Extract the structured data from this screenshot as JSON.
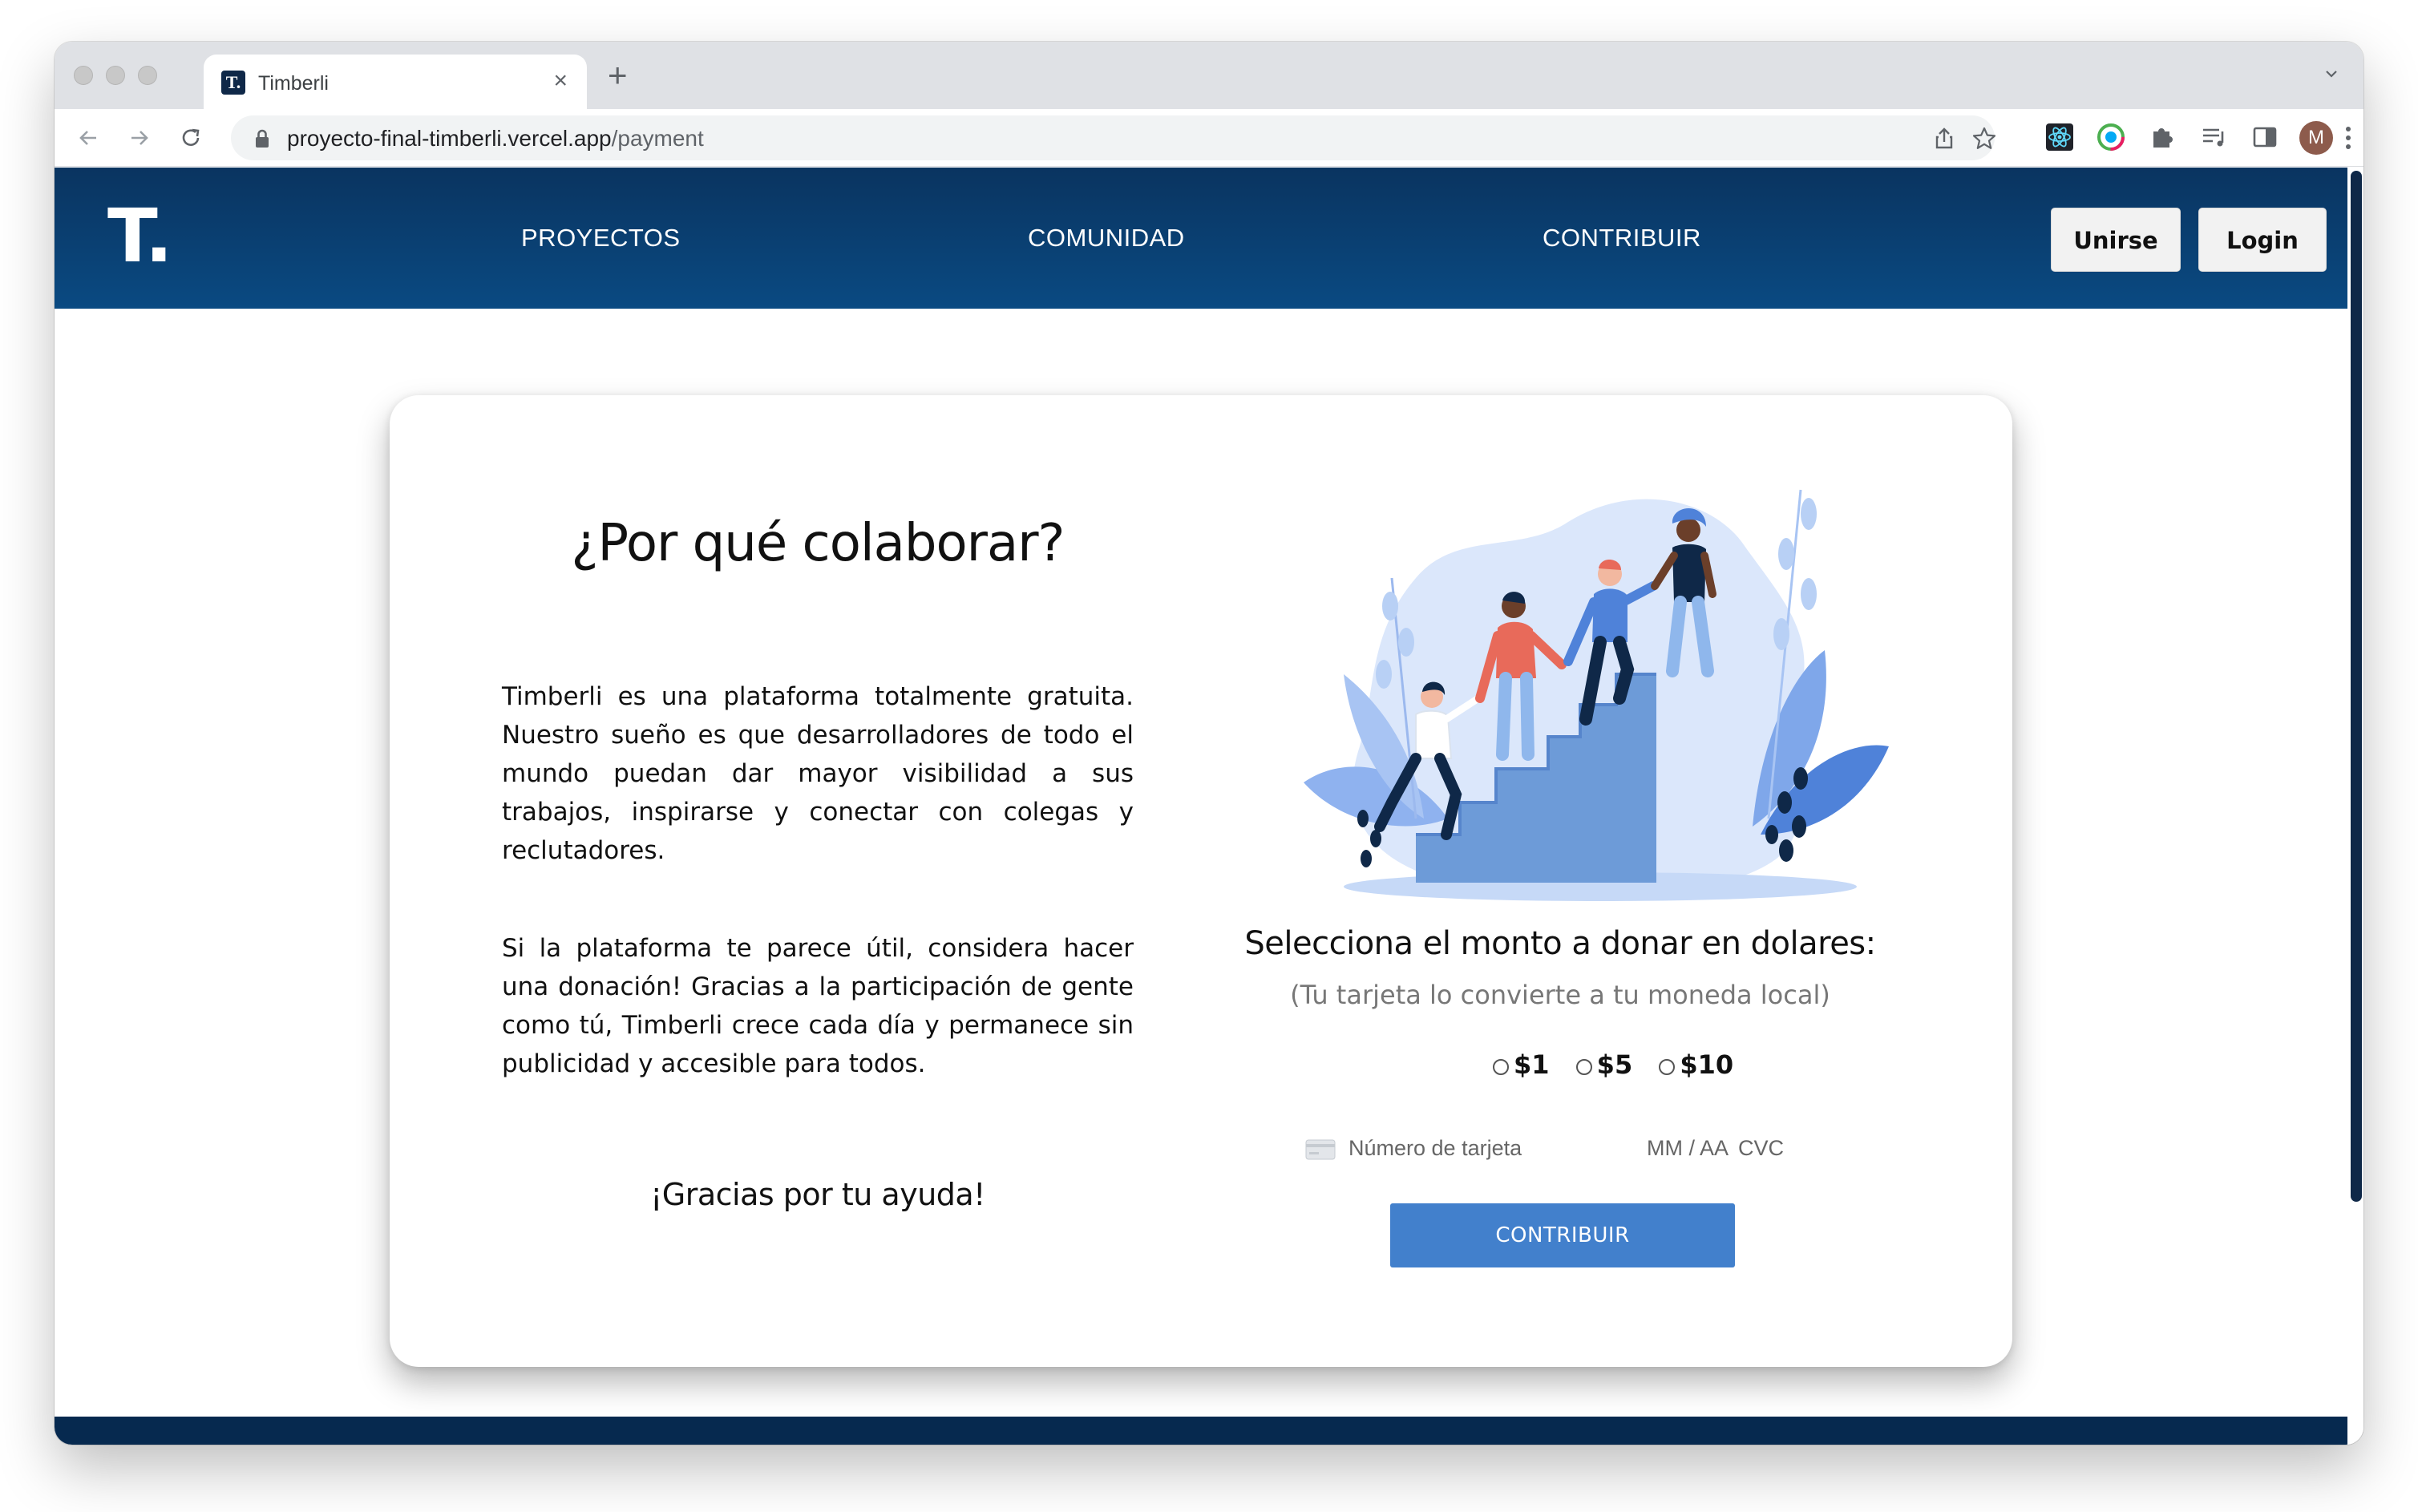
{
  "browser": {
    "tab_title": "Timberli",
    "tab_favicon_letter": "T.",
    "url_host": "proyecto-final-timberli.vercel.app",
    "url_path": "/payment",
    "profile_initial": "M"
  },
  "header": {
    "logo": "T.",
    "nav": [
      "PROYECTOS",
      "COMUNIDAD",
      "CONTRIBUIR"
    ],
    "join_label": "Unirse",
    "login_label": "Login",
    "bg_color": "#0a4a82"
  },
  "main": {
    "title": "¿Por qué colaborar?",
    "paragraph1": "Timberli es una plataforma totalmente gratuita. Nuestro sueño es que desarrolladores de todo el mundo puedan dar mayor visibilidad a sus trabajos, inspirarse y conectar con colegas y reclutadores.",
    "paragraph2": "Si la plataforma te parece útil, considera hacer una donación! Gracias a la participación de gente como tú, Timberli crece cada día y permanece sin publicidad y accesible para todos.",
    "thanks": "¡Gracias por tu ayuda!"
  },
  "donation": {
    "title": "Selecciona el monto a donar en dolares:",
    "subtitle": "(Tu tarjeta lo convierte a tu moneda local)",
    "amounts": [
      "$1",
      "$5",
      "$10"
    ],
    "card_number_placeholder": "Número de tarjeta",
    "expiry_placeholder": "MM / AA",
    "cvc_placeholder": "CVC",
    "submit_label": "CONTRIBUIR",
    "button_color": "#4280cc"
  }
}
